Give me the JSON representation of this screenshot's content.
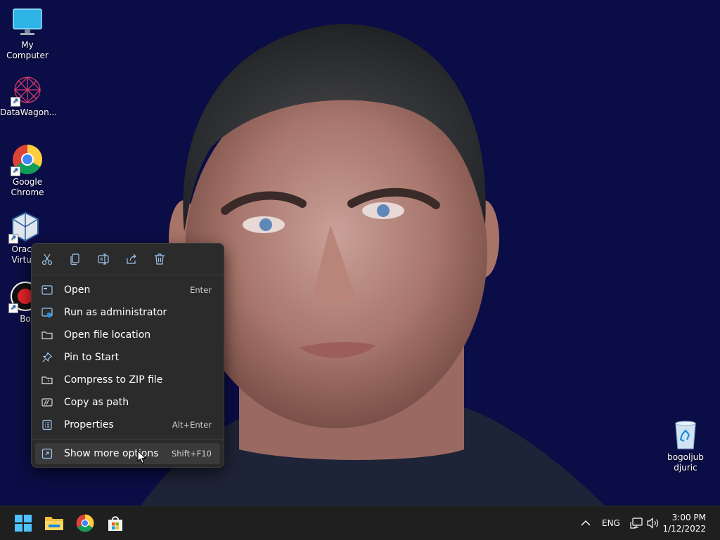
{
  "desktop": {
    "icons": [
      {
        "label": "My Computer",
        "icon": "monitor-icon"
      },
      {
        "label": "DataWagon...",
        "icon": "datawagon-icon"
      },
      {
        "label": "Google Chrome",
        "icon": "chrome-icon"
      },
      {
        "label": "Oracle Virtual",
        "icon": "virtualbox-icon"
      },
      {
        "label": "Bo",
        "icon": "record-icon"
      },
      {
        "label": "bogoljub djuric",
        "icon": "recycle-bin-icon"
      }
    ]
  },
  "context_menu": {
    "toolbar": [
      "cut-icon",
      "copy-icon",
      "rename-icon",
      "share-icon",
      "delete-icon"
    ],
    "items": [
      {
        "label": "Open",
        "shortcut": "Enter",
        "icon": "open-icon"
      },
      {
        "label": "Run as administrator",
        "shortcut": "",
        "icon": "shield-icon"
      },
      {
        "label": "Open file location",
        "shortcut": "",
        "icon": "folder-icon"
      },
      {
        "label": "Pin to Start",
        "shortcut": "",
        "icon": "pin-icon"
      },
      {
        "label": "Compress to ZIP file",
        "shortcut": "",
        "icon": "zip-icon"
      },
      {
        "label": "Copy as path",
        "shortcut": "",
        "icon": "path-icon"
      },
      {
        "label": "Properties",
        "shortcut": "Alt+Enter",
        "icon": "properties-icon"
      },
      {
        "label": "Show more options",
        "shortcut": "Shift+F10",
        "icon": "more-options-icon"
      }
    ]
  },
  "taskbar": {
    "apps": [
      "start-icon",
      "file-explorer-icon",
      "chrome-icon",
      "store-icon"
    ],
    "tray": {
      "language": "ENG",
      "time": "3:00 PM",
      "date": "1/12/2022"
    }
  },
  "colors": {
    "wallpaper": "#0b0d46",
    "menu_bg": "#2b2b2b",
    "taskbar_bg": "#1f1f1f",
    "accent": "#0a58c9"
  }
}
